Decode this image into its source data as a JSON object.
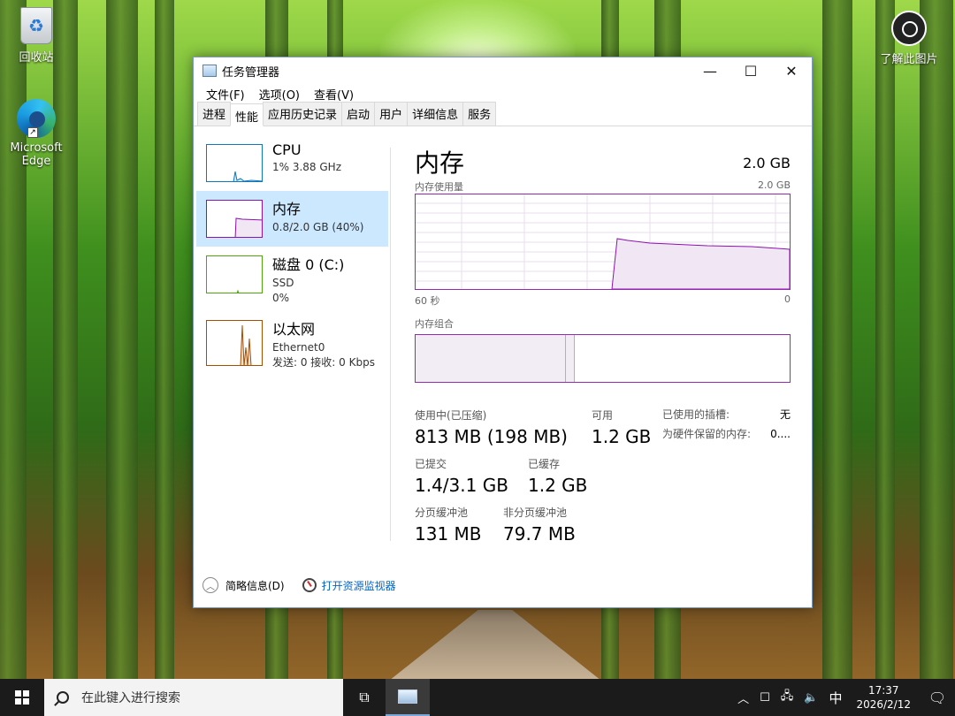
{
  "desktop": {
    "icons": [
      {
        "label": "回收站"
      },
      {
        "label": "Microsoft Edge"
      },
      {
        "label": "了解此图片"
      }
    ]
  },
  "window": {
    "title": "任务管理器",
    "controls": {
      "minimize": "—",
      "maximize": "☐",
      "close": "✕"
    },
    "menu": [
      "文件(F)",
      "选项(O)",
      "查看(V)"
    ],
    "tabs": [
      "进程",
      "性能",
      "应用历史记录",
      "启动",
      "用户",
      "详细信息",
      "服务"
    ],
    "active_tab": "性能"
  },
  "sidebar": [
    {
      "name": "CPU",
      "line1": "1% 3.88 GHz",
      "line2": "",
      "color": "#1177bb"
    },
    {
      "name": "内存",
      "line1": "0.8/2.0 GB (40%)",
      "line2": "",
      "color": "#8b12ae"
    },
    {
      "name": "磁盘 0 (C:)",
      "line1": "SSD",
      "line2": "0%",
      "color": "#4da60c"
    },
    {
      "name": "以太网",
      "line1": "Ethernet0",
      "line2": "发送: 0 接收: 0 Kbps",
      "color": "#a74f01"
    }
  ],
  "memory": {
    "heading": "内存",
    "total": "2.0 GB",
    "usage_label": "内存使用量",
    "usage_max": "2.0 GB",
    "axis_left": "60 秒",
    "axis_right": "0",
    "composition_label": "内存组合",
    "stats": {
      "in_use_label": "使用中(已压缩)",
      "in_use_value": "813 MB (198 MB)",
      "available_label": "可用",
      "available_value": "1.2 GB",
      "committed_label": "已提交",
      "committed_value": "1.4/3.1 GB",
      "cached_label": "已缓存",
      "cached_value": "1.2 GB",
      "paged_label": "分页缓冲池",
      "paged_value": "131 MB",
      "nonpaged_label": "非分页缓冲池",
      "nonpaged_value": "79.7 MB"
    },
    "details": {
      "slots_label": "已使用的插槽:",
      "slots_value": "无",
      "reserved_label": "为硬件保留的内存:",
      "reserved_value": "0...."
    }
  },
  "footer": {
    "fewer_details": "简略信息(D)",
    "resource_monitor": "打开资源监视器"
  },
  "taskbar": {
    "search_placeholder": "在此键入进行搜索",
    "ime": "中",
    "time": "17:37",
    "date": "2026/2/12"
  }
}
